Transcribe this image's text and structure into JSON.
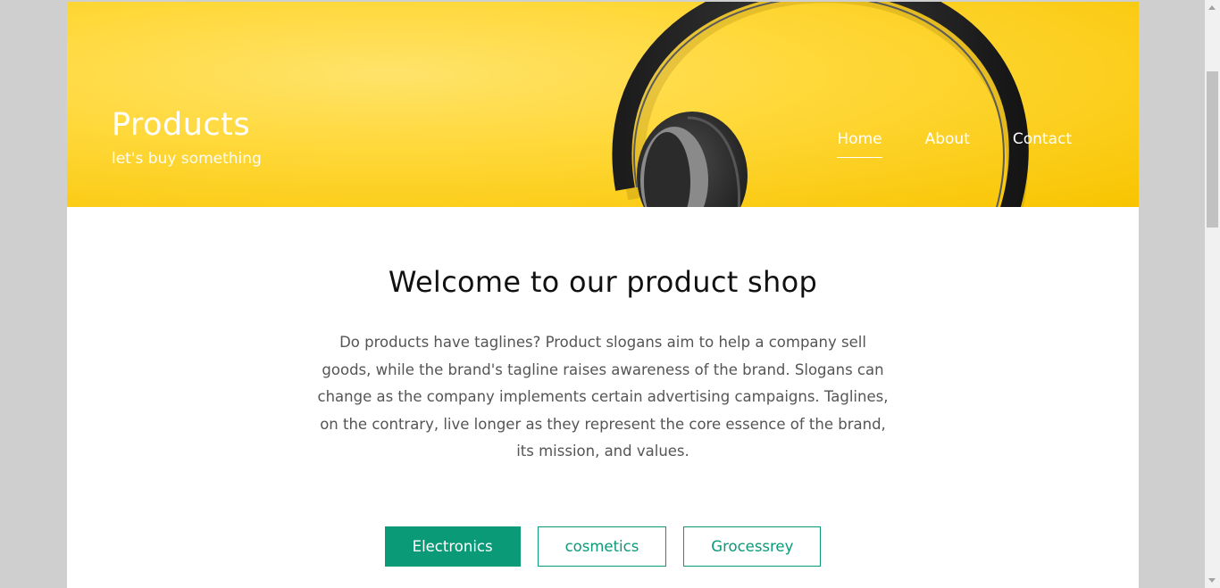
{
  "header": {
    "title": "Products",
    "tagline": "let's buy something",
    "nav": [
      {
        "label": "Home"
      },
      {
        "label": "About"
      },
      {
        "label": "Contact"
      }
    ]
  },
  "main": {
    "heading": "Welcome to our product shop",
    "intro": "Do products have taglines? Product slogans aim to help a company sell goods, while the brand's tagline raises awareness of the brand. Slogans can change as the company implements certain advertising campaigns. Taglines, on the contrary, live longer as they represent the core essence of the brand, its mission, and values."
  },
  "filters": [
    {
      "label": "Electronics"
    },
    {
      "label": "cosmetics"
    },
    {
      "label": "Grocessrey"
    }
  ],
  "colors": {
    "accent": "#0a9a78",
    "hero_yellow": "#ffd83a",
    "background": "#cfcfcf"
  },
  "icons": {
    "hero_image": "headphones-image"
  }
}
